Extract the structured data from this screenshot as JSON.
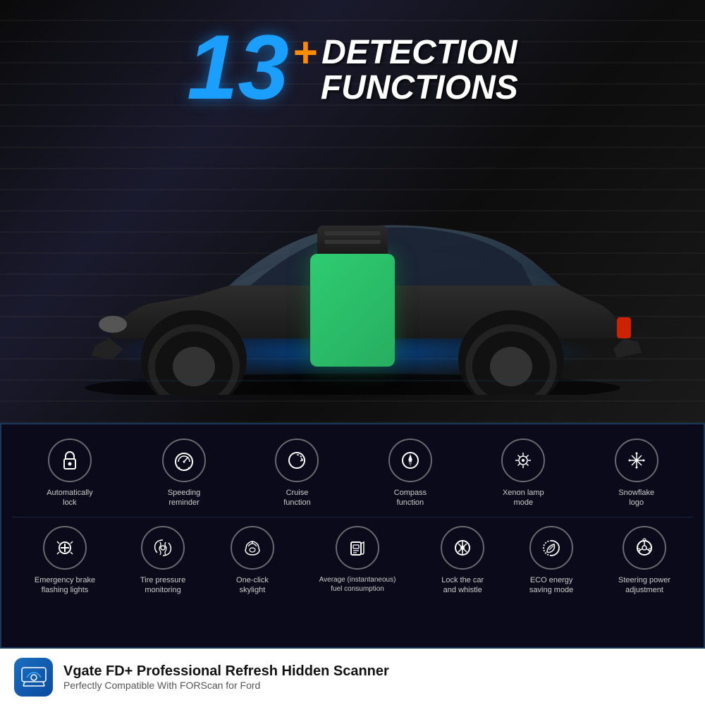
{
  "hero": {
    "number": "13",
    "plus": "+",
    "line1": "DETECTION",
    "line2": "FUNCTIONS"
  },
  "features": {
    "row1": [
      {
        "icon": "🔒",
        "label": "Automatically\nlock"
      },
      {
        "icon": "⏱",
        "label": "Speeding\nreminder"
      },
      {
        "icon": "↺",
        "label": "Cruise\nfunction"
      },
      {
        "icon": "🧭",
        "label": "Compass\nfunction"
      },
      {
        "icon": "💡",
        "label": "Xenon lamp\nmode"
      },
      {
        "icon": "❄",
        "label": "Snowflake\nlogo"
      }
    ],
    "row2": [
      {
        "icon": "🔦",
        "label": "Emergency brake\nflashing lights"
      },
      {
        "icon": "〰",
        "label": "Tire pressure\nmonitoring"
      },
      {
        "icon": "🪟",
        "label": "One-click\nskylight"
      },
      {
        "icon": "⛽",
        "label": "Average (instantaneous)\nfuel consumption"
      },
      {
        "icon": "🔔",
        "label": "Lock the car\nand whistle"
      },
      {
        "icon": "🌿",
        "label": "ECO energy\nsaving mode"
      },
      {
        "icon": "⚙",
        "label": "Steering power\nadjustment"
      }
    ]
  },
  "bottom": {
    "app_icon": "🚗",
    "title": "Vgate FD+ Professional Refresh Hidden Scanner",
    "subtitle": "Perfectly Compatible With FORScan for Ford"
  }
}
